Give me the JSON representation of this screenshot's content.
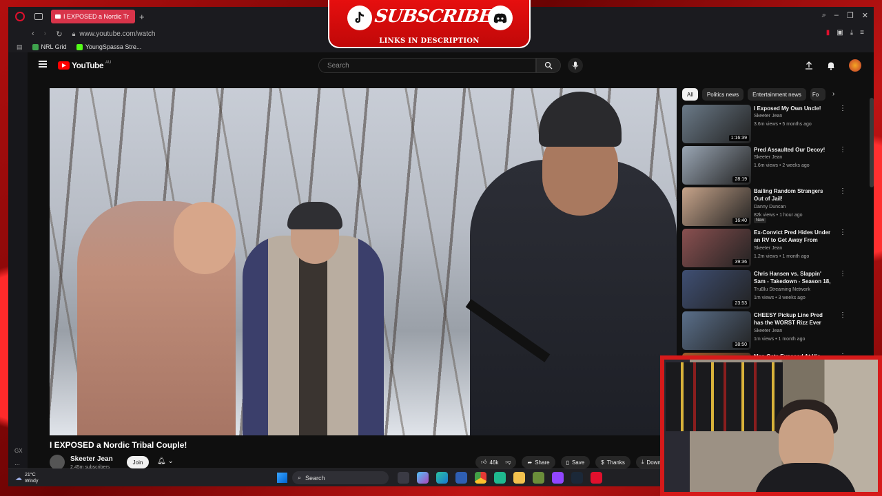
{
  "browser": {
    "tab_title": "I EXPOSED a Nordic Tr",
    "url": "www.youtube.com/watch",
    "bookmarks": [
      {
        "label": "NRL Grid",
        "color": "#3fa34d"
      },
      {
        "label": "YoungSpassa Stre...",
        "color": "#53fc18"
      }
    ]
  },
  "youtube": {
    "logo_text": "YouTube",
    "logo_region": "AU",
    "search_placeholder": "Search",
    "video": {
      "title": "I EXPOSED a Nordic Tribal Couple!",
      "channel": "Skeeter Jean",
      "subscribers": "2.45m subscribers",
      "join_label": "Join",
      "likes": "46k",
      "share_label": "Share",
      "save_label": "Save",
      "thanks_label": "Thanks",
      "download_label": "Download"
    },
    "chips": [
      "All",
      "Politics news",
      "Entertainment news",
      "Fo"
    ],
    "recommendations": [
      {
        "title": "I Exposed My Own Uncle!",
        "channel": "Skeeter Jean",
        "meta": "3.6m views • 5 months ago",
        "duration": "1:16:39",
        "thumb": "#6b7a88",
        "badge": ""
      },
      {
        "title": "Pred Assaulted Our Decoy!",
        "channel": "Skeeter Jean",
        "meta": "1.6m views • 2 weeks ago",
        "duration": "28:19",
        "thumb": "#9aa6b4",
        "badge": ""
      },
      {
        "title": "Bailing Random Strangers Out of Jail!",
        "channel": "Danny Duncan",
        "meta": "82k views • 1 hour ago",
        "duration": "16:40",
        "thumb": "#c7a48a",
        "badge": "New"
      },
      {
        "title": "Ex-Convict Pred Hides Under an RV to Get Away From Police!",
        "channel": "Skeeter Jean",
        "meta": "1.2m views • 1 month ago",
        "duration": "39:36",
        "thumb": "#8a5050",
        "badge": ""
      },
      {
        "title": "Chris Hansen vs. Slappin' Sam - Takedown - Season 18, Episod...",
        "channel": "TruBlu Streaming Network",
        "meta": "1m views • 3 weeks ago",
        "duration": "23:53",
        "thumb": "#3f4f73",
        "badge": ""
      },
      {
        "title": "CHEESY Pickup Line Pred has the WORST Rizz Ever",
        "channel": "Skeeter Jean",
        "meta": "1m views • 1 month ago",
        "duration": "38:50",
        "thumb": "#5a6f8a",
        "badge": ""
      },
      {
        "title": "Man Gets Exposed At His Job!",
        "channel": "",
        "meta": "",
        "duration": "",
        "thumb": "#a15c2a",
        "badge": ""
      }
    ]
  },
  "taskbar": {
    "temperature": "21°C",
    "condition": "Windy",
    "search_label": "Search"
  },
  "overlay": {
    "subscribe_text": "SUBSCRIBE",
    "links_text": "LINKS IN DESCRIPTION",
    "side_label": "GX"
  }
}
